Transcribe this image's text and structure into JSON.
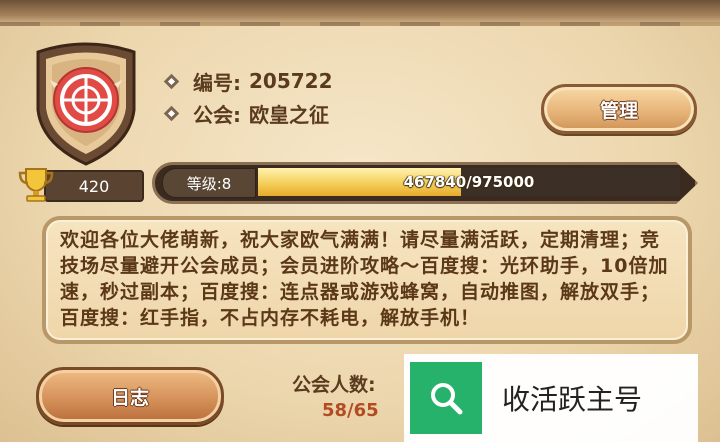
{
  "guild": {
    "id_label": "编号:",
    "id_value": "205722",
    "name_label": "公会:",
    "name_value": "欧皇之征"
  },
  "buttons": {
    "manage": "管理",
    "log": "日志"
  },
  "trophy_points": "420",
  "level": {
    "label": "等级:8",
    "exp_text": "467840/975000",
    "exp_progress": 0.48
  },
  "notice": "欢迎各位大佬萌新，祝大家欧气满满！请尽量满活跃，定期清理；竞技场尽量避开公会成员；会员进阶攻略～百度搜：光环助手，10倍加速，秒过副本；百度搜：连点器或游戏蜂窝，自动推图，解放双手；百度搜：红手指，不占内存不耗电，解放手机！",
  "members": {
    "label": "公会人数:",
    "count": "58/65"
  },
  "watermark": {
    "text": "收活跃主号",
    "icon": "search-icon"
  },
  "colors": {
    "brown_text": "#5a3b1f",
    "count_red": "#b24c22",
    "exp_gold": "#f4cf5a",
    "watermark_green": "#26b26a"
  }
}
